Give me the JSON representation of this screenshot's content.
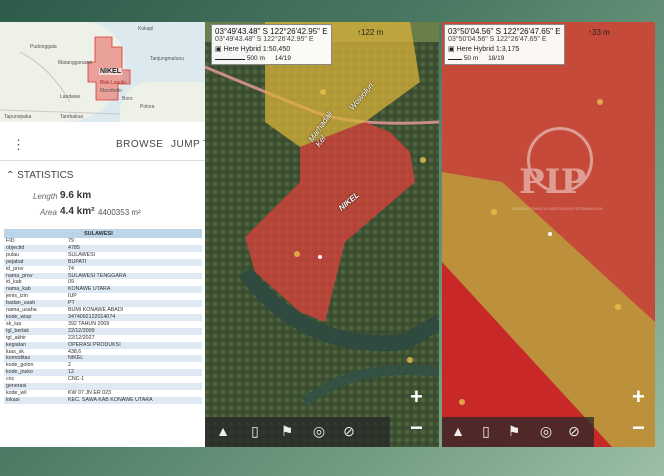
{
  "left_panel": {
    "minimap": {
      "labels": [
        "Pudonggala",
        "Matanggonawe",
        "Kokapi",
        "Tanjungmalunu",
        "Boro",
        "Mandiodo",
        "Polora",
        "Landawe",
        "Tapunopaka",
        "Tambakua"
      ],
      "highlight_label": "NIKEL",
      "region_label": "Blok Lasolo"
    },
    "menu": {
      "dots": "⋮",
      "browse": "BROWSE",
      "jump": "JUMP T"
    },
    "statistics": {
      "title": "STATISTICS",
      "length_label": "Length",
      "length_value": "9.6 km",
      "area_label": "Area",
      "area_value": "4.4 km²",
      "area_m": "4400353 m²"
    },
    "table_header": "SULAWESI",
    "rows": [
      [
        "FID",
        "79"
      ],
      [
        "objectid",
        "4785"
      ],
      [
        "pulau",
        "SULAWESI"
      ],
      [
        "pejabat",
        "BUPATI"
      ],
      [
        "id_prov",
        "74"
      ],
      [
        "nama_prov",
        "SULAWESI TENGGARA"
      ],
      [
        "id_kab",
        "09"
      ],
      [
        "nama_kab",
        "KONAWE UTARA"
      ],
      [
        "jenis_izin",
        "IUP"
      ],
      [
        "badan_usah",
        "PT"
      ],
      [
        "nama_usaha",
        "BUMI KONAWE ABADI"
      ],
      [
        "kode_wiup",
        "3474092122014074"
      ],
      [
        "sk_iup",
        "392 TAHUN 2009"
      ],
      [
        "tgl_berlak",
        "22/12/2009"
      ],
      [
        "tgl_akhir",
        "22/12/2027"
      ],
      [
        "kegiatan",
        "OPERASI PRODUKSI"
      ],
      [
        "luas_sk",
        "438,6"
      ],
      [
        "komoditas",
        "NIKEL"
      ],
      [
        "kode_golon",
        "2"
      ],
      [
        "kode_jnsko",
        "12"
      ],
      [
        "cnc",
        "CNC-1"
      ],
      [
        "generasi",
        ""
      ],
      [
        "kode_wil",
        "KW 07 JN ER 023"
      ],
      [
        "lokasi",
        "KEC. SAWA KAB KONAWE UTARA"
      ]
    ]
  },
  "mid_map": {
    "coord_main": "03°49'43.48\" S 122°26'42.95\" E",
    "altitude": "↑122 m",
    "coord_small": "03°49'43.48\" S 122°26'42.95\" E",
    "layer": "Here Hybrid 1:50,450",
    "scale": "500 m",
    "zoom_level": "14/19",
    "road_labels": [
      "Wowoluri",
      "Marhadali",
      "Kel"
    ],
    "feature_label": "NIKEL",
    "zoom_in": "+",
    "zoom_out": "−"
  },
  "right_map": {
    "coord_main": "03°50'04.56\" S 122°26'47.65\" E",
    "altitude": "↑33 m",
    "coord_small": "03°50'04.56\" S 122°26'47.65\" E",
    "layer": "Here Hybrid 1:3,175",
    "scale": "50 m",
    "zoom_level": "18/19",
    "watermark": "PIP",
    "watermark_sub": "LEMBAGA PEMANTAU INDEPENDEN PERTAMBANGAN",
    "zoom_in": "+",
    "zoom_out": "−"
  },
  "toolbar_icons": [
    "mountain-icon",
    "map-icon",
    "flag-icon",
    "target-icon",
    "compass-lock-icon"
  ],
  "colors": {
    "concession_red": "#e3403a",
    "concession_yellow": "#d9b23a",
    "table_header_blue": "#bcd4e8"
  }
}
